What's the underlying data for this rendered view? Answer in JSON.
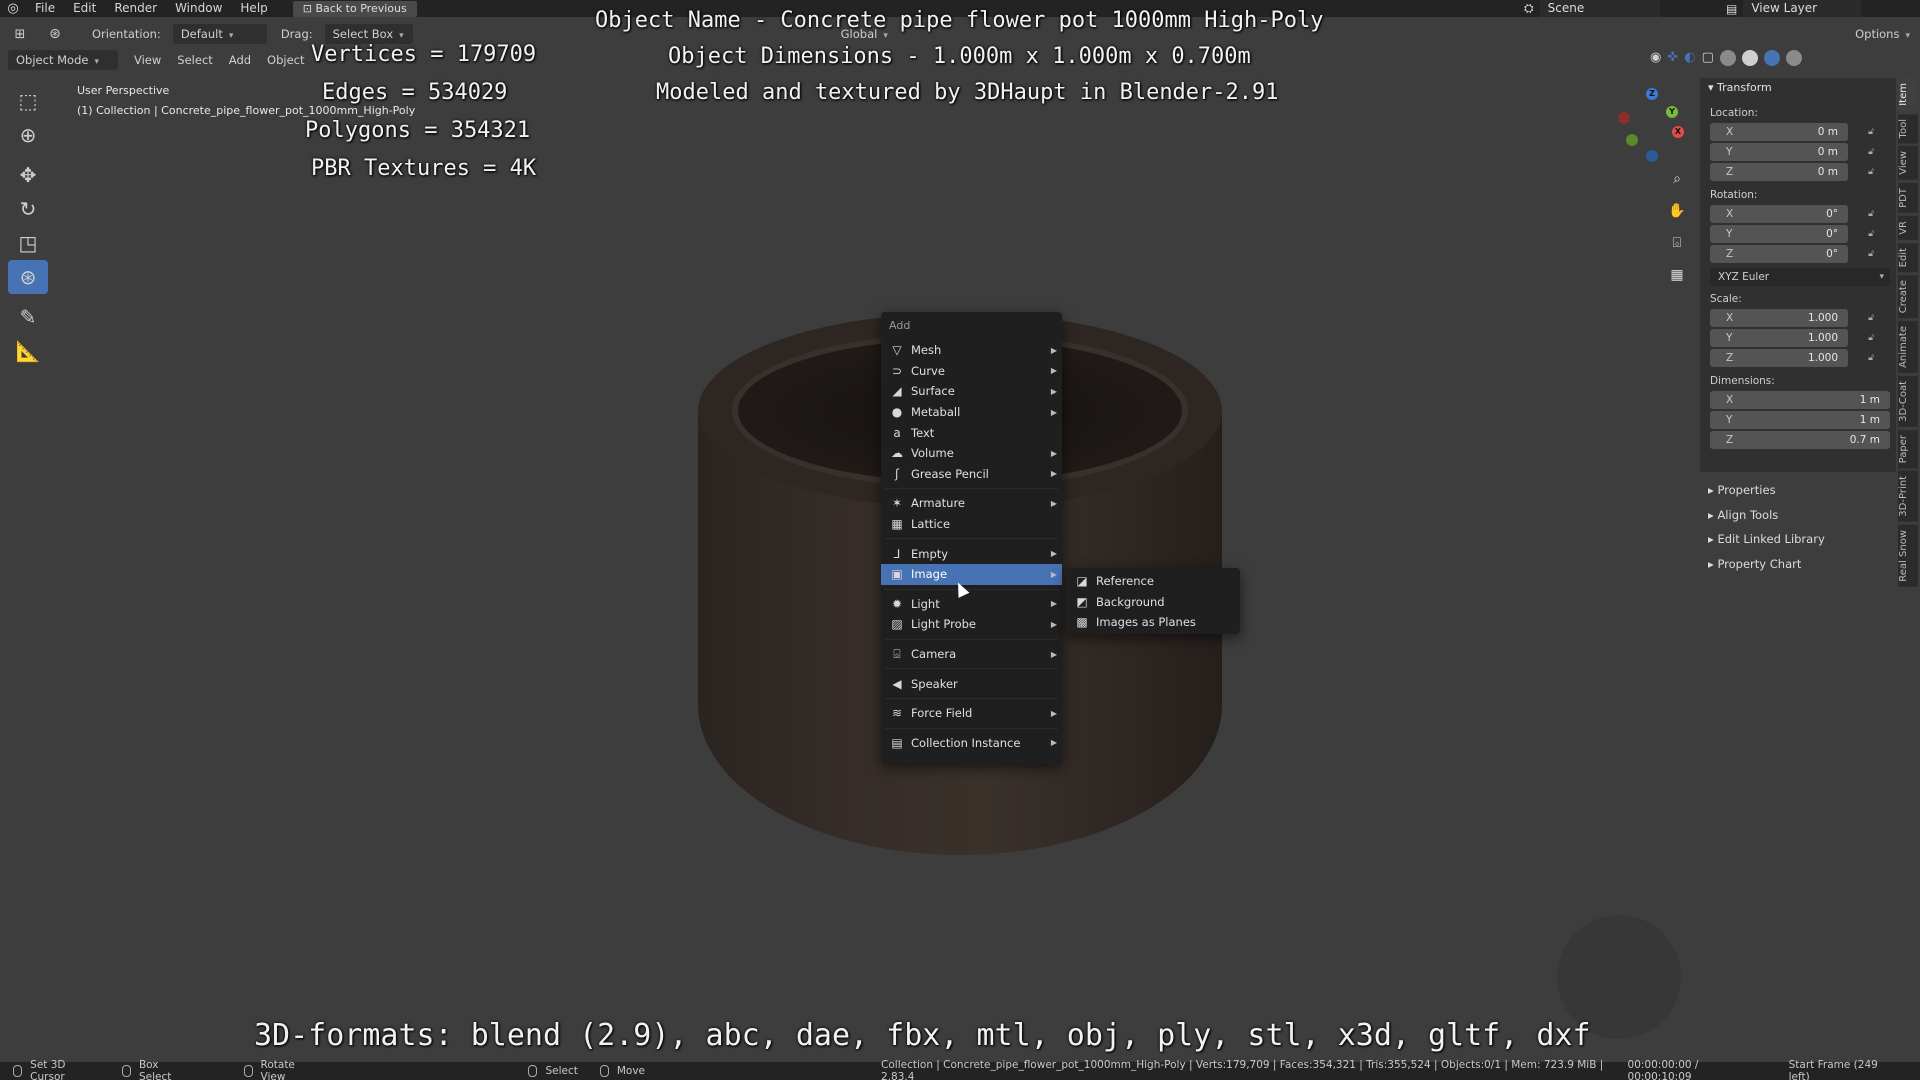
{
  "topbar": {
    "menus": [
      "File",
      "Edit",
      "Render",
      "Window",
      "Help"
    ],
    "back_button": "Back to Previous",
    "scene_label": "Scene",
    "view_layer_label": "View Layer"
  },
  "header": {
    "orientation_label": "Orientation:",
    "orientation_value": "Default",
    "drag_label": "Drag:",
    "drag_value": "Select Box",
    "transform_space": "Global",
    "options_label": "Options",
    "mode": "Object Mode",
    "menus": [
      "View",
      "Select",
      "Add",
      "Object"
    ]
  },
  "viewport": {
    "perspective": "User Perspective",
    "collection_line": "(1) Collection | Concrete_pipe_flower_pot_1000mm_High-Poly"
  },
  "overlay_stats": {
    "vertices": "Vertices = 179709",
    "edges": "Edges = 534029",
    "polygons": "Polygons = 354321",
    "textures": "PBR Textures = 4K"
  },
  "overlay_title": {
    "name": "Object Name - Concrete pipe flower pot 1000mm High-Poly",
    "dims": "Object Dimensions -  1.000m x 1.000m x 0.700m",
    "credit": "Modeled and textured by 3DHaupt in Blender-2.91"
  },
  "overlay_formats": "3D-formats: blend (2.9), abc, dae, fbx, mtl, obj, ply, stl, x3d, gltf, dxf",
  "add_menu": {
    "title": "Add",
    "items": [
      {
        "label": "Mesh",
        "icon": "mesh-icon",
        "glyph": "▽",
        "sub": true
      },
      {
        "label": "Curve",
        "icon": "curve-icon",
        "glyph": "⊃",
        "sub": true
      },
      {
        "label": "Surface",
        "icon": "surface-icon",
        "glyph": "◢",
        "sub": true
      },
      {
        "label": "Metaball",
        "icon": "metaball-icon",
        "glyph": "●",
        "sub": true
      },
      {
        "label": "Text",
        "icon": "text-icon",
        "glyph": "a",
        "sub": false
      },
      {
        "label": "Volume",
        "icon": "volume-icon",
        "glyph": "☁",
        "sub": true
      },
      {
        "label": "Grease Pencil",
        "icon": "grease-pencil-icon",
        "glyph": "ʃ",
        "sub": true
      },
      {
        "label": "Armature",
        "icon": "armature-icon",
        "glyph": "✶",
        "sub": true
      },
      {
        "label": "Lattice",
        "icon": "lattice-icon",
        "glyph": "▦",
        "sub": false
      },
      {
        "label": "Empty",
        "icon": "empty-icon",
        "glyph": "⅃",
        "sub": true
      },
      {
        "label": "Image",
        "icon": "image-icon",
        "glyph": "▣",
        "sub": true
      },
      {
        "label": "Light",
        "icon": "light-icon",
        "glyph": "✹",
        "sub": true
      },
      {
        "label": "Light Probe",
        "icon": "light-probe-icon",
        "glyph": "▨",
        "sub": true
      },
      {
        "label": "Camera",
        "icon": "camera-icon",
        "glyph": "⌺",
        "sub": true
      },
      {
        "label": "Speaker",
        "icon": "speaker-icon",
        "glyph": "◀",
        "sub": false
      },
      {
        "label": "Force Field",
        "icon": "force-field-icon",
        "glyph": "≋",
        "sub": true
      },
      {
        "label": "Collection Instance",
        "icon": "collection-instance-icon",
        "glyph": "▤",
        "sub": true
      }
    ]
  },
  "image_submenu": {
    "items": [
      {
        "label": "Reference",
        "icon": "reference-image-icon",
        "glyph": "◪"
      },
      {
        "label": "Background",
        "icon": "background-image-icon",
        "glyph": "◩"
      },
      {
        "label": "Images as Planes",
        "icon": "images-as-planes-icon",
        "glyph": "▩"
      }
    ]
  },
  "npanel": {
    "transform_header": "Transform",
    "location_label": "Location:",
    "location": [
      {
        "axis": "X",
        "value": "0 m"
      },
      {
        "axis": "Y",
        "value": "0 m"
      },
      {
        "axis": "Z",
        "value": "0 m"
      }
    ],
    "rotation_label": "Rotation:",
    "rotation": [
      {
        "axis": "X",
        "value": "0°"
      },
      {
        "axis": "Y",
        "value": "0°"
      },
      {
        "axis": "Z",
        "value": "0°"
      }
    ],
    "rotation_mode": "XYZ Euler",
    "scale_label": "Scale:",
    "scale": [
      {
        "axis": "X",
        "value": "1.000"
      },
      {
        "axis": "Y",
        "value": "1.000"
      },
      {
        "axis": "Z",
        "value": "1.000"
      }
    ],
    "dimensions_label": "Dimensions:",
    "dimensions": [
      {
        "axis": "X",
        "value": "1 m"
      },
      {
        "axis": "Y",
        "value": "1 m"
      },
      {
        "axis": "Z",
        "value": "0.7 m"
      }
    ],
    "panels": [
      "Properties",
      "Align Tools",
      "Edit Linked Library",
      "Property Chart"
    ]
  },
  "vertical_tabs": [
    "Item",
    "Tool",
    "View",
    "PDT",
    "VR",
    "Edit",
    "Create",
    "Animate",
    "3D-Coat",
    "Paper",
    "3D-Print",
    "Real Snow"
  ],
  "statusbar": {
    "set_cursor": "Set 3D Cursor",
    "box_select": "Box Select",
    "rotate_view": "Rotate View",
    "select": "Select",
    "move": "Move",
    "info": "Collection | Concrete_pipe_flower_pot_1000mm_High-Poly | Verts:179,709 | Faces:354,321 | Tris:355,524 | Objects:0/1 | Mem: 723.9 MiB | 2.83.4",
    "time": "00:00:00:00 / 00:00:10:09",
    "frame": "Start Frame (249 left)"
  },
  "colors": {
    "accent": "#4772b3",
    "background": "#3d3d3d",
    "menu_bg": "#1f1f1f"
  }
}
